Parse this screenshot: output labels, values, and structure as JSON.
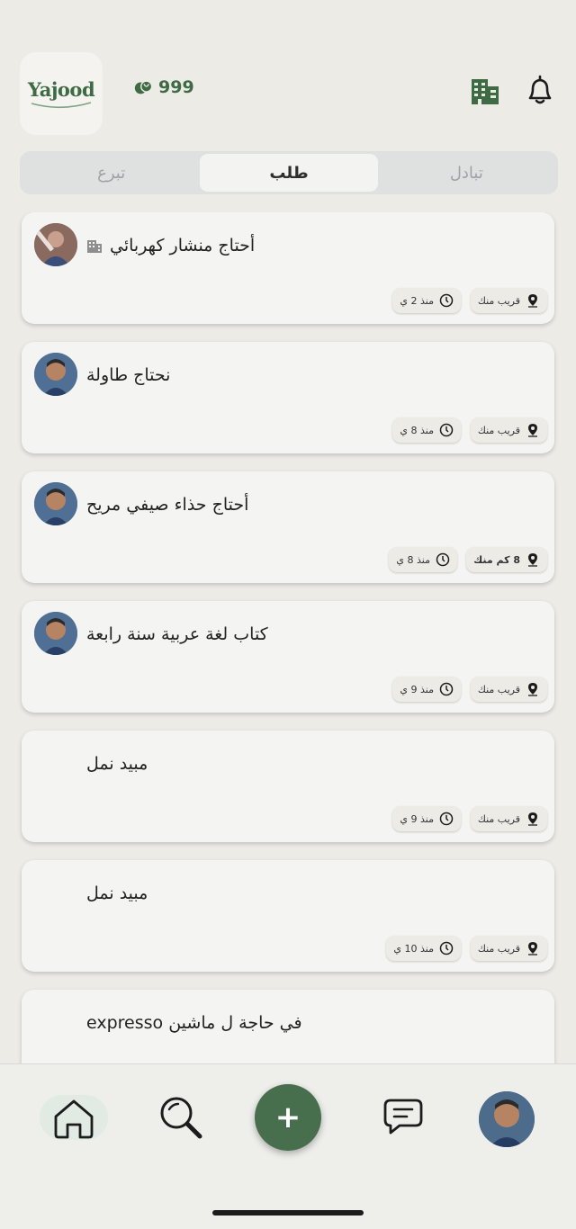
{
  "header": {
    "logo_text": "Yajood",
    "points": "999"
  },
  "tabs": [
    {
      "label": "تبادل",
      "active": false
    },
    {
      "label": "طلب",
      "active": true
    },
    {
      "label": "تبرع",
      "active": false
    }
  ],
  "posts": [
    {
      "title": "أحتاج منشار كهربائي",
      "location": "قريب منك",
      "time": "منذ 2 ي",
      "avatar": true,
      "business": true
    },
    {
      "title": "نحتاج طاولة",
      "location": "قريب منك",
      "time": "منذ 8 ي",
      "avatar": true,
      "business": false
    },
    {
      "title": "أحتاج حذاء صيفي مريح",
      "location": "8 كم منك",
      "time": "منذ 8 ي",
      "avatar": true,
      "business": false
    },
    {
      "title": "كتاب لغة عربية سنة رابعة",
      "location": "قريب منك",
      "time": "منذ 9 ي",
      "avatar": true,
      "business": false
    },
    {
      "title": "مبيد نمل",
      "location": "قريب منك",
      "time": "منذ 9 ي",
      "avatar": false,
      "business": false
    },
    {
      "title": "مبيد نمل",
      "location": "قريب منك",
      "time": "منذ 10 ي",
      "avatar": false,
      "business": false
    },
    {
      "title": "في حاجة ل ماشين expresso",
      "location": "",
      "time": "",
      "avatar": false,
      "business": false
    }
  ],
  "nav": {
    "fab_label": "+"
  },
  "colors": {
    "brand_green": "#476e4d",
    "background": "#ecebe6",
    "card": "#f4f4f2"
  }
}
